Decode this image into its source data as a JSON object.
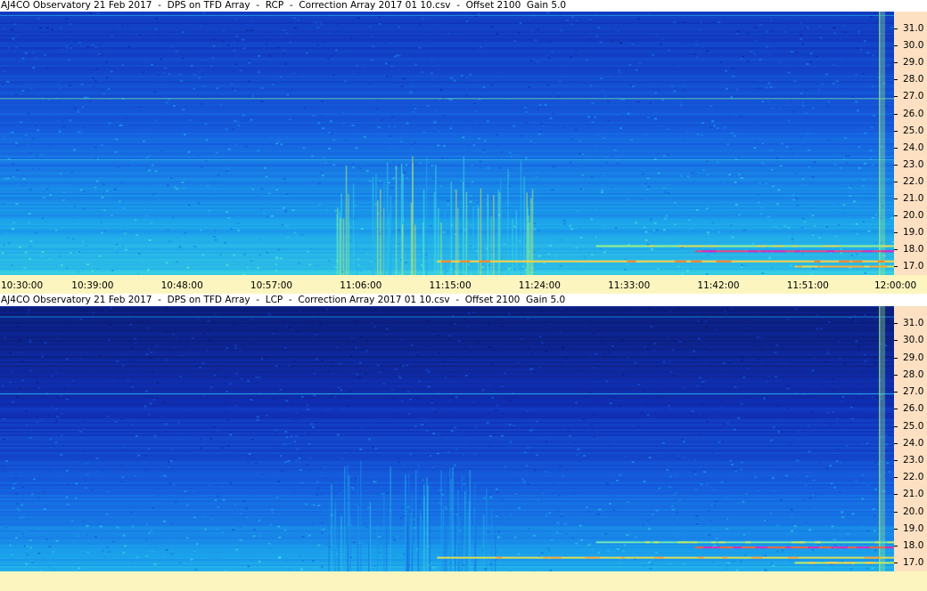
{
  "chart_data": [
    {
      "type": "heatmap",
      "title": "AJ4CO Observatory 21 Feb 2017  -  DPS on TFD Array  -  RCP  -  Correction Array 2017 01 10.csv  -  Offset 2100  Gain 5.0",
      "xlabel": "",
      "ylabel": "",
      "x_ticks": [
        "10:30:00",
        "10:39:00",
        "10:48:00",
        "10:57:00",
        "11:06:00",
        "11:15:00",
        "11:24:00",
        "11:33:00",
        "11:42:00",
        "11:51:00",
        "12:00:00"
      ],
      "y_ticks": [
        "31.0",
        "30.0",
        "29.0",
        "28.0",
        "27.0",
        "26.0",
        "25.0",
        "24.0",
        "23.0",
        "22.0",
        "21.0",
        "20.0",
        "19.0",
        "18.0",
        "17.0"
      ],
      "xlim": [
        "10:30:00",
        "12:00:00"
      ],
      "ylim": [
        16.5,
        32.0
      ],
      "polarization": "RCP",
      "colormap": [
        "#0a1a70",
        "#1030b8",
        "#1560e0",
        "#1aa0ec",
        "#40e0e0",
        "#b0f070",
        "#ffd040",
        "#ff7020",
        "#d030c0"
      ],
      "features": [
        {
          "kind": "background_gradient",
          "low_freq_level": 0.45,
          "high_freq_level": 0.15
        },
        {
          "kind": "horizontal_line",
          "freq": 26.9,
          "level": 0.55
        },
        {
          "kind": "horizontal_line",
          "freq": 23.3,
          "level": 0.45
        },
        {
          "kind": "horizontal_line",
          "freq": 31.8,
          "level": 0.4
        },
        {
          "kind": "burst_region",
          "t_start": "11:03:00",
          "t_end": "11:24:00",
          "f_low": 16.5,
          "f_high": 23.5,
          "level": 0.7
        },
        {
          "kind": "vertical_band",
          "t": "11:58:40",
          "level": 0.6
        },
        {
          "kind": "emission_band",
          "t_start": "11:14:00",
          "t_end": "12:00:00",
          "freq": 17.3,
          "level": 0.75
        },
        {
          "kind": "emission_band",
          "t_start": "11:40:00",
          "t_end": "12:00:00",
          "freq": 17.9,
          "level": 0.95
        },
        {
          "kind": "emission_band",
          "t_start": "11:30:00",
          "t_end": "12:00:00",
          "freq": 18.2,
          "level": 0.6
        },
        {
          "kind": "emission_band",
          "t_start": "11:50:00",
          "t_end": "12:00:00",
          "freq": 17.0,
          "level": 0.7
        }
      ]
    },
    {
      "type": "heatmap",
      "title": "AJ4CO Observatory 21 Feb 2017  -  DPS on TFD Array  -  LCP  -  Correction Array 2017 01 10.csv  -  Offset 2100  Gain 5.0",
      "xlabel": "",
      "ylabel": "",
      "x_ticks": [],
      "y_ticks": [
        "31.0",
        "30.0",
        "29.0",
        "28.0",
        "27.0",
        "26.0",
        "25.0",
        "24.0",
        "23.0",
        "22.0",
        "21.0",
        "20.0",
        "19.0",
        "18.0",
        "17.0"
      ],
      "xlim": [
        "10:30:00",
        "12:00:00"
      ],
      "ylim": [
        16.5,
        32.0
      ],
      "polarization": "LCP",
      "colormap": [
        "#0a1a70",
        "#1030b8",
        "#1560e0",
        "#1aa0ec",
        "#40e0e0",
        "#b0f070",
        "#ffd040",
        "#ff7020",
        "#d030c0"
      ],
      "features": [
        {
          "kind": "background_gradient",
          "low_freq_level": 0.4,
          "high_freq_level": 0.03
        },
        {
          "kind": "horizontal_line",
          "freq": 26.9,
          "level": 0.45
        },
        {
          "kind": "horizontal_line",
          "freq": 31.4,
          "level": 0.35
        },
        {
          "kind": "burst_region",
          "t_start": "11:03:00",
          "t_end": "11:20:00",
          "f_low": 16.5,
          "f_high": 23.0,
          "level": 0.45
        },
        {
          "kind": "vertical_band",
          "t": "11:58:40",
          "level": 0.6
        },
        {
          "kind": "emission_band",
          "t_start": "11:14:00",
          "t_end": "12:00:00",
          "freq": 17.3,
          "level": 0.7
        },
        {
          "kind": "emission_band",
          "t_start": "11:40:00",
          "t_end": "12:00:00",
          "freq": 17.9,
          "level": 0.9
        },
        {
          "kind": "emission_band",
          "t_start": "11:30:00",
          "t_end": "12:00:00",
          "freq": 18.2,
          "level": 0.55
        },
        {
          "kind": "emission_band",
          "t_start": "11:50:00",
          "t_end": "12:00:00",
          "freq": 17.0,
          "level": 0.65
        }
      ]
    }
  ]
}
